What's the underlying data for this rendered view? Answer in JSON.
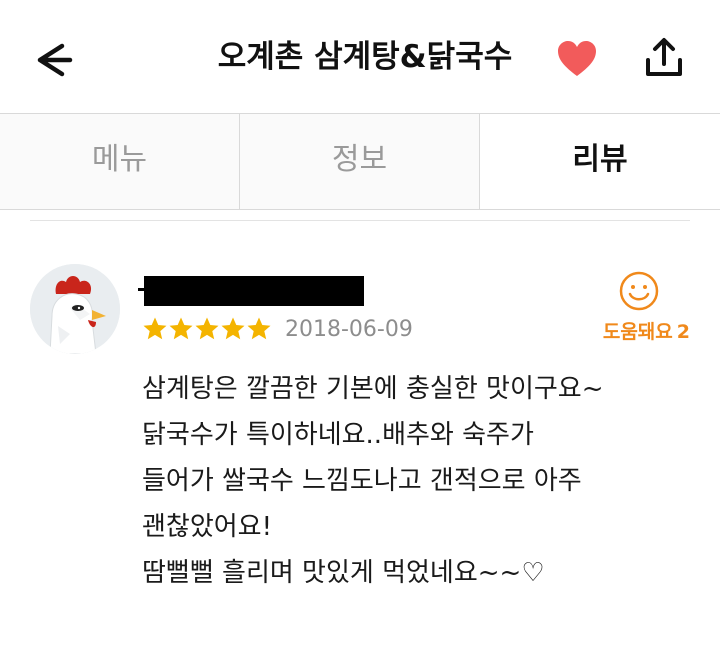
{
  "header": {
    "title": "오계촌 삼계탕&닭국수",
    "back_icon": "arrow-left-icon",
    "favorite_icon": "heart-icon",
    "share_icon": "share-icon",
    "heart_color": "#f25b5b"
  },
  "tabs": [
    {
      "label": "메뉴",
      "active": false
    },
    {
      "label": "정보",
      "active": false
    },
    {
      "label": "리뷰",
      "active": true
    }
  ],
  "review": {
    "rating": 5,
    "star_color": "#f4b400",
    "date": "2018-06-09",
    "helpful": {
      "label": "도움돼요",
      "count": "2",
      "icon": "smiley-icon",
      "color": "#f0891b"
    },
    "body_lines": [
      "삼계탕은 깔끔한 기본에 충실한 맛이구요~",
      "닭국수가 특이하네요..배추와 숙주가",
      "들어가 쌀국수 느낌도나고 갠적으로 아주",
      "괜찮았어요!",
      "땀뻘뻘 흘리며 맛있게 먹었네요~~♡"
    ]
  }
}
